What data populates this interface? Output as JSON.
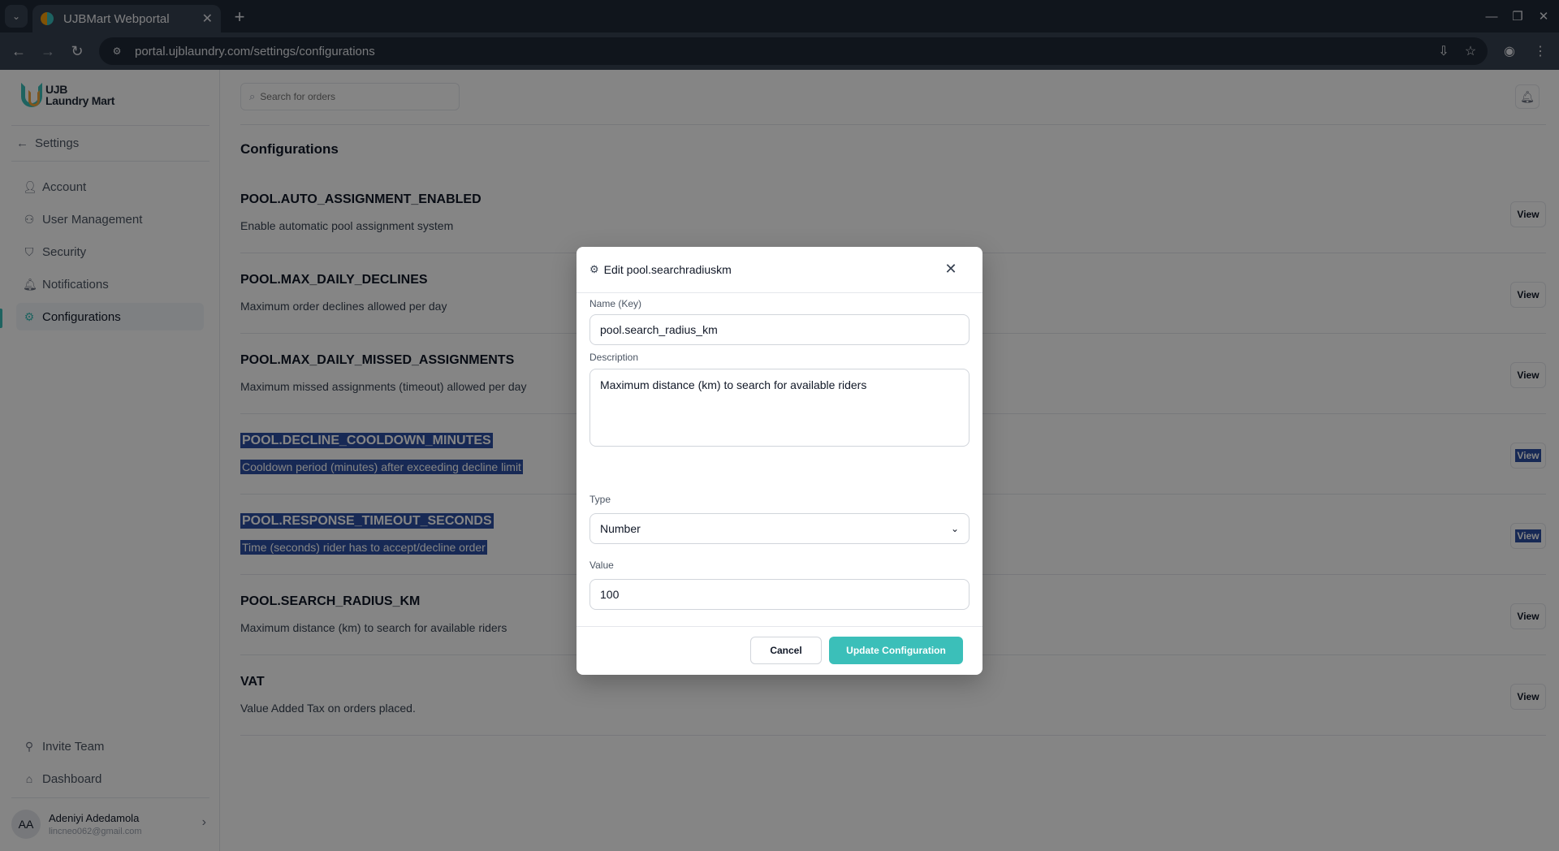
{
  "browser": {
    "tab_title": "UJBMart Webportal",
    "url": "portal.ujblaundry.com/settings/configurations"
  },
  "sidebar": {
    "logo_line1": "UJB",
    "logo_line2": "Laundry Mart",
    "back_label": "Settings",
    "items": [
      {
        "label": "Account",
        "icon": "user-icon"
      },
      {
        "label": "User Management",
        "icon": "users-icon"
      },
      {
        "label": "Security",
        "icon": "shield-icon"
      },
      {
        "label": "Notifications",
        "icon": "bell-icon"
      },
      {
        "label": "Configurations",
        "icon": "gear-icon",
        "active": true
      }
    ],
    "bottom_items": [
      {
        "label": "Invite Team",
        "icon": "user-plus-icon"
      },
      {
        "label": "Dashboard",
        "icon": "home-icon"
      }
    ],
    "user": {
      "initials": "AA",
      "name": "Adeniyi Adedamola",
      "email": "lincneo062@gmail.com"
    }
  },
  "header": {
    "search_placeholder": "Search for orders"
  },
  "page": {
    "title": "Configurations",
    "view_label": "View",
    "configs": [
      {
        "key": "POOL.AUTO_ASSIGNMENT_ENABLED",
        "description": "Enable automatic pool assignment system",
        "selected": false
      },
      {
        "key": "POOL.MAX_DAILY_DECLINES",
        "description": "Maximum order declines allowed per day",
        "selected": false
      },
      {
        "key": "POOL.MAX_DAILY_MISSED_ASSIGNMENTS",
        "description": "Maximum missed assignments (timeout) allowed per day",
        "selected": false
      },
      {
        "key": "POOL.DECLINE_COOLDOWN_MINUTES",
        "description": "Cooldown period (minutes) after exceeding decline limit",
        "selected": true
      },
      {
        "key": "POOL.RESPONSE_TIMEOUT_SECONDS",
        "description": "Time (seconds) rider has to accept/decline order",
        "selected": true
      },
      {
        "key": "POOL.SEARCH_RADIUS_KM",
        "description": "Maximum distance (km) to search for available riders",
        "selected": false
      },
      {
        "key": "VAT",
        "description": "Value Added Tax on orders placed.",
        "selected": false
      }
    ]
  },
  "modal": {
    "title": "Edit pool.searchradiuskm",
    "name_label": "Name (Key)",
    "name_value": "pool.search_radius_km",
    "description_label": "Description",
    "description_value": "Maximum distance (km) to search for available riders",
    "type_label": "Type",
    "type_value": "Number",
    "value_label": "Value",
    "value_value": "100",
    "cancel_label": "Cancel",
    "update_label": "Update Configuration"
  },
  "colors": {
    "accent": "#3bbfb9",
    "selection": "#2d4fa3"
  }
}
